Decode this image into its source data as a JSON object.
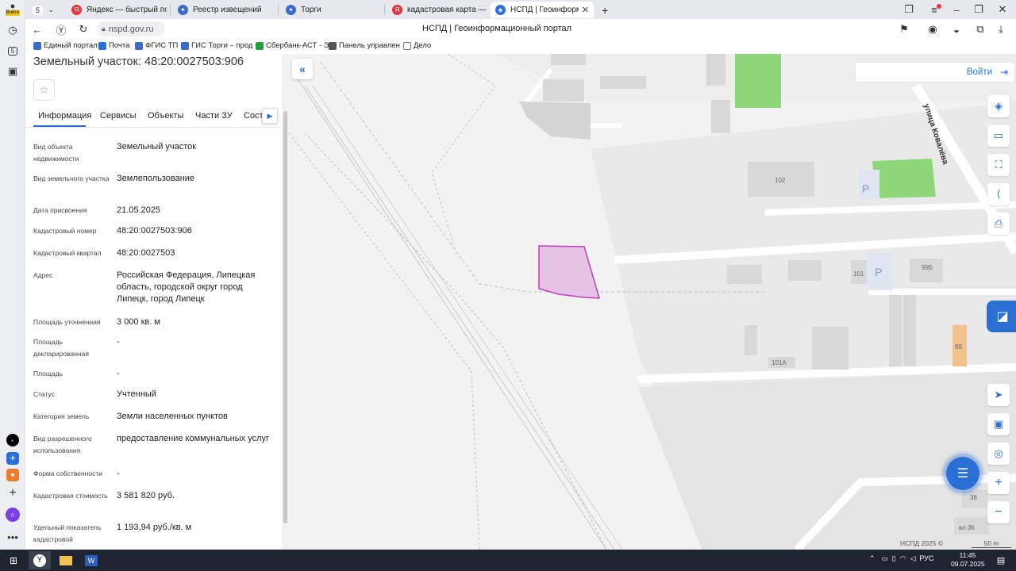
{
  "rail": {
    "login_label": "Войти"
  },
  "tabs": [
    {
      "label": "Яндекс — быстрый поиск",
      "icon_color": "#e8333b"
    },
    {
      "label": "Реестр извещений",
      "icon_color": "#3b6cc9"
    },
    {
      "label": "Торги",
      "icon_color": "#3b6cc9"
    },
    {
      "label": "кадастровая карта — Янд",
      "icon_color": "#e8333b"
    },
    {
      "label": "НСПД | Геоинформацио",
      "icon_color": "#2a6fd6"
    }
  ],
  "tab_count_badge": "5",
  "address": {
    "url": "nspd.gov.ru",
    "page_title": "НСПД | Геоинформационный портал"
  },
  "bookmarks": [
    {
      "label": "Единый портал",
      "color": "#3b6cc9"
    },
    {
      "label": "Почта",
      "color": "#2a6fd6"
    },
    {
      "label": "ФГИС ТП",
      "color": "#3b6cc9"
    },
    {
      "label": "ГИС Торги – прод",
      "color": "#3b6cc9"
    },
    {
      "label": "Сбербанк-АСТ - Э",
      "color": "#21a038"
    },
    {
      "label": "Панель управлен",
      "color": "#555555"
    },
    {
      "label": "Дело",
      "color": "#777777"
    }
  ],
  "panel": {
    "title": "Земельный участок: 48:20:0027503:906",
    "tabs": [
      "Информация",
      "Сервисы",
      "Объекты",
      "Части ЗУ",
      "Соста"
    ],
    "fields": [
      {
        "label": "Вид объекта недвижимости",
        "value": "Земельный участок"
      },
      {
        "label": "Вид земельного участка",
        "value": "Землепользование"
      },
      {
        "label": "Дата присвоения",
        "value": "21.05.2025"
      },
      {
        "label": "Кадастровый номер",
        "value": "48:20:0027503:906"
      },
      {
        "label": "Кадастровый квартал",
        "value": "48:20:0027503"
      },
      {
        "label": "Адрес",
        "value": "Российская Федерация, Липецкая область, городской округ город Липецк, город Липецк"
      },
      {
        "label": "Площадь уточненная",
        "value": "3 000 кв. м"
      },
      {
        "label": "Площадь декларированная",
        "value": "-"
      },
      {
        "label": "Площадь",
        "value": "-"
      },
      {
        "label": "Статус",
        "value": "Учтенный"
      },
      {
        "label": "Категория земель",
        "value": "Земли населенных пунктов"
      },
      {
        "label": "Вид разрешенного использования",
        "value": "предоставление коммунальных услуг"
      },
      {
        "label": "Форма собственности",
        "value": "-"
      },
      {
        "label": "Кадастровая стоимость",
        "value": "3 581 820 руб."
      },
      {
        "label": "Удельный показатель кадастровой",
        "value": "1 193,94 руб./кв. м"
      }
    ]
  },
  "map": {
    "login_label": "Войти",
    "street_label": "улица Ковалёва",
    "building_labels": [
      "102",
      "101",
      "99Б",
      "101А",
      "99",
      "38",
      "вл 36"
    ],
    "parking_label": "P",
    "footer": "НСПД 2025 ©",
    "scale": "50 m",
    "colors": {
      "parcel_fill": "#e6c3e6",
      "parcel_stroke": "#b93fb9",
      "green": "#8fd67a",
      "building": "#d8d8d8",
      "accent": "#2a6fd6"
    }
  },
  "taskbar": {
    "language": "РУС",
    "time": "11:45",
    "date": "09.07.2025"
  }
}
